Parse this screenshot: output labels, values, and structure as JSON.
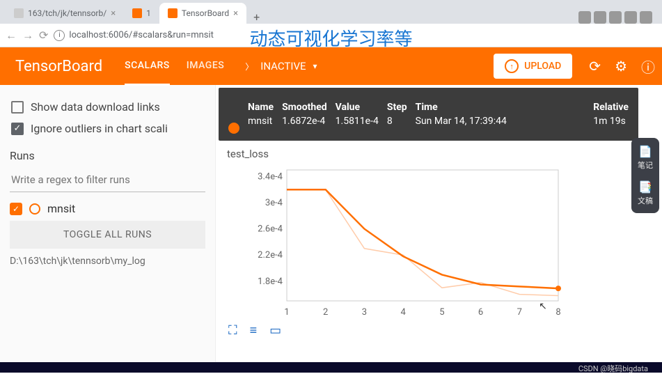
{
  "browser": {
    "tabs": [
      {
        "title": "163/tch/jk/tennsorb/",
        "active": false
      },
      {
        "title": "1",
        "active": false
      },
      {
        "title": "TensorBoard",
        "active": true
      }
    ],
    "url": "localhost:6006/#scalars&run=mnsit"
  },
  "overlay_text": "动态可视化学习率等",
  "header": {
    "logo": "TensorBoard",
    "tabs": [
      {
        "label": "SCALARS",
        "active": true
      },
      {
        "label": "IMAGES",
        "active": false
      }
    ],
    "dropdown": {
      "label": "INACTIVE"
    },
    "upload": "UPLOAD"
  },
  "sidebar": {
    "opt_download": "Show data download links",
    "opt_outliers": "Ignore outliers in chart scali",
    "runs_header": "Runs",
    "filter_placeholder": "Write a regex to filter runs",
    "runs": [
      {
        "name": "mnsit",
        "checked": true
      }
    ],
    "toggle_label": "TOGGLE ALL RUNS",
    "logdir": "D:\\163\\tch\\jk\\tennsorb\\my_log"
  },
  "tooltip": {
    "headers": {
      "name": "Name",
      "smoothed": "Smoothed",
      "value": "Value",
      "step": "Step",
      "time": "Time",
      "relative": "Relative"
    },
    "row": {
      "name": "mnsit",
      "smoothed": "1.6872e-4",
      "value": "1.5811e-4",
      "step": "8",
      "time": "Sun Mar 14, 17:39:44",
      "relative": "1m 19s"
    }
  },
  "card_title_hidden": "test_loss",
  "chart_data": {
    "type": "line",
    "title": "test_loss",
    "x": [
      1,
      2,
      3,
      4,
      5,
      6,
      7,
      8
    ],
    "series": [
      {
        "name": "mnsit_smoothed",
        "values": [
          0.00032,
          0.00032,
          0.00026,
          0.000218,
          0.00019,
          0.000175,
          0.000172,
          0.000169
        ],
        "color": "#ff6f00"
      },
      {
        "name": "mnsit_raw",
        "values": [
          0.00032,
          0.00032,
          0.00023,
          0.00022,
          0.00017,
          0.000178,
          0.00016,
          0.000158
        ],
        "color": "#ffccaa"
      }
    ],
    "xlabel": "",
    "ylabel": "",
    "yticks_labels": [
      "3.4e-4",
      "3e-4",
      "2.6e-4",
      "2.2e-4",
      "1.8e-4"
    ],
    "yticks_values": [
      0.00034,
      0.0003,
      0.00026,
      0.00022,
      0.00018
    ],
    "xlim": [
      1,
      8
    ],
    "ylim": [
      0.00015,
      0.00035
    ]
  },
  "float_widget": {
    "item1": "笔记",
    "item2": "文稿"
  },
  "footer": "CSDN @晓码bigdata"
}
